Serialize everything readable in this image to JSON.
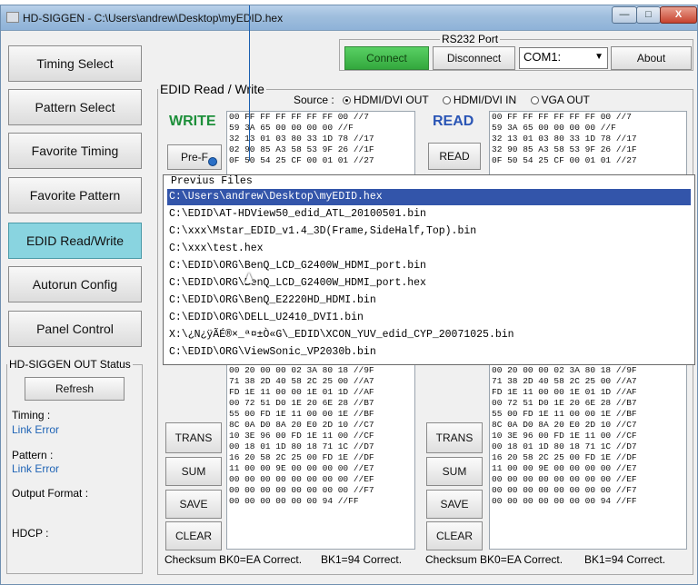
{
  "window": {
    "title": "HD-SIGGEN  - C:\\Users\\andrew\\Desktop\\myEDID.hex",
    "min_icon": "minimize-icon",
    "max_icon": "maximize-icon",
    "close_icon": "close-icon",
    "min_glyph": "—",
    "max_glyph": "□",
    "close_glyph": "X"
  },
  "nav": [
    {
      "label": "Timing Select"
    },
    {
      "label": "Pattern Select"
    },
    {
      "label": "Favorite Timing"
    },
    {
      "label": "Favorite Pattern"
    },
    {
      "label": "EDID Read/Write"
    },
    {
      "label": "Autorun Config"
    },
    {
      "label": "Panel Control"
    }
  ],
  "active_nav": "EDID Read/Write",
  "rs232": {
    "legend": "RS232 Port",
    "connect": "Connect",
    "disconnect": "Disconnect",
    "port": "COM1:",
    "about": "About",
    "colors": {
      "connect": "#3cb846"
    }
  },
  "edid": {
    "legend": "EDID Read / Write",
    "source_label": "Source :",
    "source_options": [
      "HDMI/DVI OUT",
      "HDMI/DVI IN",
      "VGA OUT"
    ],
    "source_selected": "HDMI/DVI OUT",
    "write_label": "WRITE",
    "read_label": "READ",
    "prefile_button": "Pre-F",
    "read_button": "READ",
    "write_hex_top": "00 FF FF FF FF FF FF 00 //7\n59 3A 65 00 00 00 00 //F\n32 13 01 03 80 33 1D 78 //17\n02 90 85 A3 58 53 9F 26 //1F\n0F 50 54 25 CF 00 01 01 //27",
    "read_hex_top": "00 FF FF FF FF FF FF 00 //7\n59 3A 65 00 00 00 00 //F\n32 13 01 03 80 33 1D 78 //17\n32 90 85 A3 58 53 9F 26 //1F\n0F 50 54 25 CF 00 01 01 //27",
    "write_hex_bottom": "00 20 00 00 02 3A 80 18 //9F\n71 38 2D 40 58 2C 25 00 //A7\nFD 1E 11 00 00 1E 01 1D //AF\n00 72 51 D0 1E 20 6E 28 //B7\n55 00 FD 1E 11 00 00 1E //BF\n8C 0A D0 8A 20 E0 2D 10 //C7\n10 3E 96 00 FD 1E 11 00 //CF\n00 18 01 1D 80 18 71 1C //D7\n16 20 58 2C 25 00 FD 1E //DF\n11 00 00 9E 00 00 00 00 //E7\n00 00 00 00 00 00 00 00 //EF\n00 00 00 00 00 00 00 00 //F7\n00 00 00 00 00 00 94 //FF",
    "read_hex_bottom": "00 20 00 00 02 3A 80 18 //9F\n71 38 2D 40 58 2C 25 00 //A7\nFD 1E 11 00 00 1E 01 1D //AF\n00 72 51 D0 1E 20 6E 28 //B7\n55 00 FD 1E 11 00 00 1E //BF\n8C 0A D0 8A 20 E0 2D 10 //C7\n10 3E 96 00 FD 1E 11 00 //CF\n00 18 01 1D 80 18 71 1C //D7\n16 20 58 2C 25 00 FD 1E //DF\n11 00 00 9E 00 00 00 00 //E7\n00 00 00 00 00 00 00 00 //EF\n00 00 00 00 00 00 00 00 //F7\n00 00 00 00 00 00 00 94 //FF",
    "left_buttons": {
      "trans": "TRANS",
      "sum": "SUM",
      "save": "SAVE",
      "clear": "CLEAR"
    },
    "right_buttons": {
      "trans": "TRANS",
      "sum": "SUM",
      "save": "SAVE",
      "clear": "CLEAR"
    },
    "checksum_left": "Checksum BK0=EA Correct.",
    "checksum_left_bk1": "BK1=94 Correct.",
    "checksum_right": "Checksum BK0=EA Correct.",
    "checksum_right_bk1": "BK1=94 Correct."
  },
  "previous_files": {
    "legend": "Previus Files",
    "items": [
      "C:\\Users\\andrew\\Desktop\\myEDID.hex",
      "C:\\EDID\\AT-HDView50_edid_ATL_20100501.bin",
      "C:\\xxx\\Mstar_EDID_v1.4_3D(Frame,SideHalf,Top).bin",
      "C:\\xxx\\test.hex",
      "C:\\EDID\\ORG\\BenQ_LCD_G2400W_HDMI_port.bin",
      "C:\\EDID\\ORG\\BenQ_LCD_G2400W_HDMI_port.hex",
      "C:\\EDID\\ORG\\BenQ_E2220HD_HDMI.bin",
      "C:\\EDID\\ORG\\DELL_U2410_DVI1.bin",
      "X:\\¿N¿ÿÃÉ®×_ª¤±Ò«G\\_EDID\\XCON_YUV_edid_CYP_20071025.bin",
      "C:\\EDID\\ORG\\ViewSonic_VP2030b.bin"
    ],
    "selected_index": 0
  },
  "status": {
    "legend": "HD-SIGGEN OUT Status",
    "refresh": "Refresh",
    "timing_label": "Timing :",
    "timing_value": "Link Error",
    "pattern_label": "Pattern :",
    "pattern_value": "Link Error",
    "output_label": "Output Format :",
    "hdcp_label": "HDCP :"
  }
}
